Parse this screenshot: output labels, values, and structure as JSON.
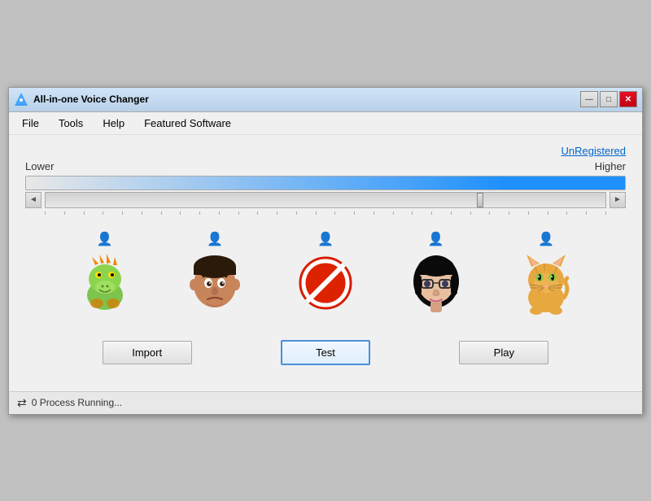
{
  "window": {
    "title": "All-in-one Voice Changer",
    "icon": "voice-changer-icon"
  },
  "titlebar_controls": {
    "minimize": "—",
    "maximize": "□",
    "close": "✕"
  },
  "menubar": {
    "items": [
      "File",
      "Tools",
      "Help",
      "Featured Software"
    ]
  },
  "status": {
    "unregistered": "UnRegistered"
  },
  "pitch": {
    "lower_label": "Lower",
    "higher_label": "Higher"
  },
  "avatars": [
    {
      "id": "dragon",
      "label": "Dragon"
    },
    {
      "id": "male-face",
      "label": "Male"
    },
    {
      "id": "no-voice",
      "label": "No Voice"
    },
    {
      "id": "female-face",
      "label": "Female"
    },
    {
      "id": "cat",
      "label": "Cat"
    }
  ],
  "buttons": {
    "import": "Import",
    "test": "Test",
    "play": "Play"
  },
  "statusbar": {
    "icon": "⇄",
    "text": "0 Process Running..."
  },
  "ticks_count": 30
}
